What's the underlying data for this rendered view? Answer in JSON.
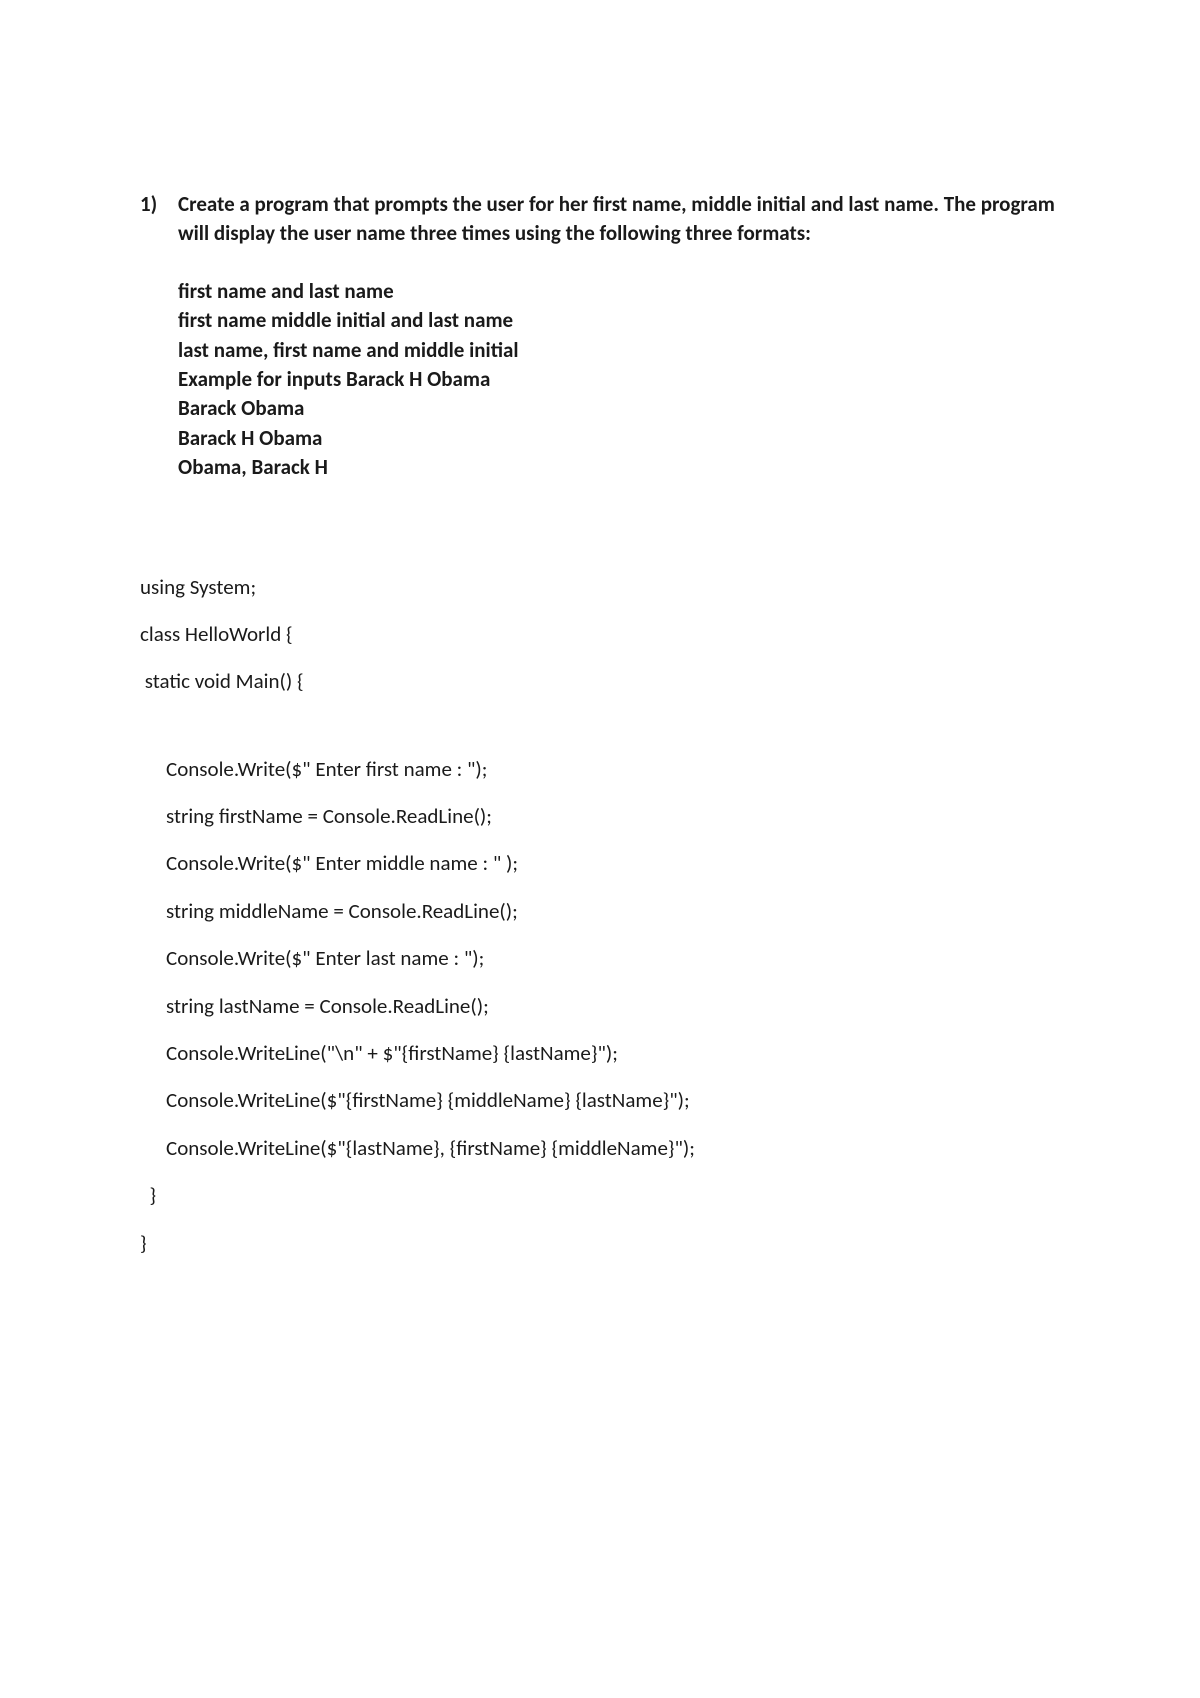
{
  "problem": {
    "number": "1)",
    "description": "Create a program that prompts the user for her first name, middle initial and last name. The program will display the user name three times using the following three formats:",
    "spec": [
      "first name and last name",
      "first name middle initial and last name",
      "last name, first name and middle initial",
      "Example for inputs Barack H Obama",
      "Barack Obama",
      "Barack H Obama",
      "Obama, Barack H"
    ]
  },
  "code": {
    "lines": [
      {
        "indent": 0,
        "text": "using System;"
      },
      {
        "indent": 0,
        "text": "class HelloWorld {"
      },
      {
        "indent": 0,
        "text": " static void Main() {"
      },
      {
        "indent": 1,
        "text": "Console.Write($\" Enter first name : \");"
      },
      {
        "indent": 1,
        "text": "string firstName = Console.ReadLine();"
      },
      {
        "indent": 1,
        "text": "Console.Write($\" Enter middle name : \" );"
      },
      {
        "indent": 1,
        "text": "string middleName = Console.ReadLine();"
      },
      {
        "indent": 1,
        "text": "Console.Write($\" Enter last name : \");"
      },
      {
        "indent": 1,
        "text": "string lastName = Console.ReadLine();"
      },
      {
        "indent": 1,
        "text": "Console.WriteLine(\"\\n\" + $\"{firstName} {lastName}\");"
      },
      {
        "indent": 1,
        "text": "Console.WriteLine($\"{firstName} {middleName} {lastName}\");"
      },
      {
        "indent": 1,
        "text": "Console.WriteLine($\"{lastName}, {firstName} {middleName}\");"
      },
      {
        "indent": 0,
        "text": "  }"
      },
      {
        "indent": 0,
        "text": "}"
      }
    ],
    "blank_after_index": 2
  }
}
